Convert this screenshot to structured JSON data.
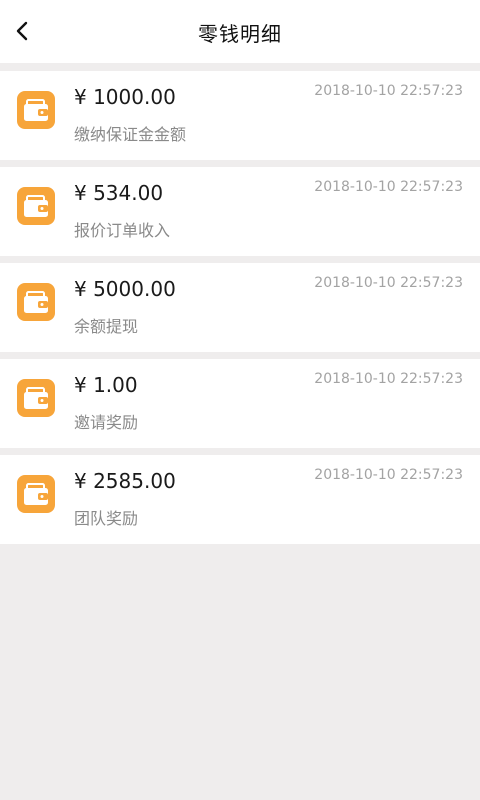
{
  "header": {
    "title": "零钱明细",
    "back_icon": "chevron-left-icon"
  },
  "transactions": [
    {
      "amount": "¥ 1000.00",
      "description": "缴纳保证金金额",
      "time": "2018-10-10 22:57:23",
      "icon": "wallet-icon"
    },
    {
      "amount": "¥ 534.00",
      "description": "报价订单收入",
      "time": "2018-10-10 22:57:23",
      "icon": "wallet-icon"
    },
    {
      "amount": "¥ 5000.00",
      "description": "余额提现",
      "time": "2018-10-10 22:57:23",
      "icon": "wallet-icon"
    },
    {
      "amount": "¥ 1.00",
      "description": "邀请奖励",
      "time": "2018-10-10 22:57:23",
      "icon": "wallet-icon"
    },
    {
      "amount": "¥ 2585.00",
      "description": "团队奖励",
      "time": "2018-10-10 22:57:23",
      "icon": "wallet-icon"
    }
  ],
  "colors": {
    "background": "#efeded",
    "surface": "#ffffff",
    "icon_accent": "#f7a53a"
  }
}
